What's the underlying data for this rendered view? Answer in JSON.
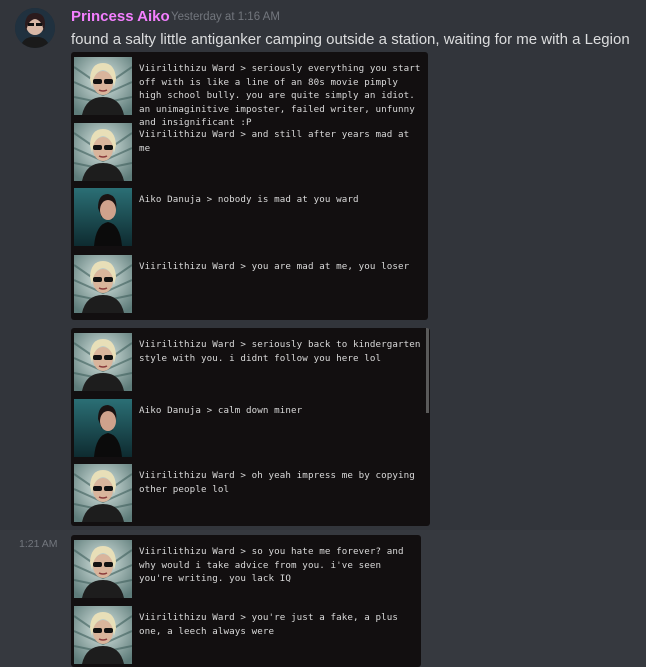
{
  "message": {
    "author": "Princess Aiko",
    "timestamp": "Yesterday at 1:16 AM",
    "text": "found a salty little antiganker camping outside a station, waiting for me with a Legion"
  },
  "followup_timestamp": "1:21 AM",
  "screenshots": [
    {
      "lines": [
        {
          "speaker": "ward",
          "text": "Viirilithizu Ward > seriously everything you start off with is like a line of an 80s movie pimply high school bully. you are quite simply an idiot. an unimaginitive imposter, failed writer, unfunny and insignificant :P"
        },
        {
          "speaker": "ward",
          "text": "Viirilithizu Ward > and still after years mad at me"
        },
        {
          "speaker": "aiko",
          "text": "Aiko Danuja > nobody is mad at you ward"
        },
        {
          "speaker": "ward",
          "text": "Viirilithizu Ward > you are mad at me, you loser"
        }
      ]
    },
    {
      "lines": [
        {
          "speaker": "ward",
          "text": "Viirilithizu Ward > seriously back to kindergarten style with you. i didnt follow you here lol"
        },
        {
          "speaker": "aiko",
          "text": "Aiko Danuja > calm down miner"
        },
        {
          "speaker": "ward",
          "text": "Viirilithizu Ward > oh yeah impress me by copying other people lol"
        }
      ]
    },
    {
      "lines": [
        {
          "speaker": "ward",
          "text": "Viirilithizu Ward > so you hate me forever? and why would i take advice from you. i've seen you're writing. you lack IQ"
        },
        {
          "speaker": "ward",
          "text": "Viirilithizu Ward > you're just a fake, a plus one, a leech always were"
        }
      ]
    }
  ],
  "colors": {
    "background": "#36393f",
    "username": "#f47fff",
    "text": "#dcddde",
    "muted": "#72767d",
    "screenshot_bg": "#120f10"
  }
}
